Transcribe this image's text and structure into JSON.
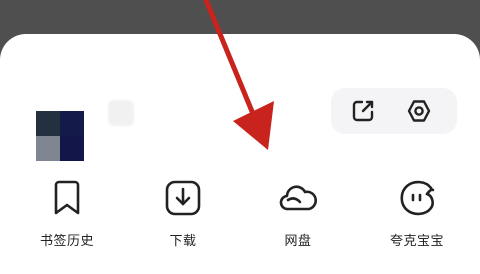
{
  "profile": {
    "avatar_colors": [
      "#223040",
      "#141a4a",
      "#7f8591",
      "#121649"
    ]
  },
  "toolbar": {
    "icons": [
      "edit-icon",
      "settings-icon"
    ]
  },
  "grid": {
    "items": [
      {
        "label": "书签历史",
        "icon": "bookmark-icon"
      },
      {
        "label": "下载",
        "icon": "download-icon"
      },
      {
        "label": "网盘",
        "icon": "cloud-icon"
      },
      {
        "label": "夸克宝宝",
        "icon": "assistant-face-icon"
      }
    ]
  },
  "annotation": {
    "color": "#c8231c"
  }
}
